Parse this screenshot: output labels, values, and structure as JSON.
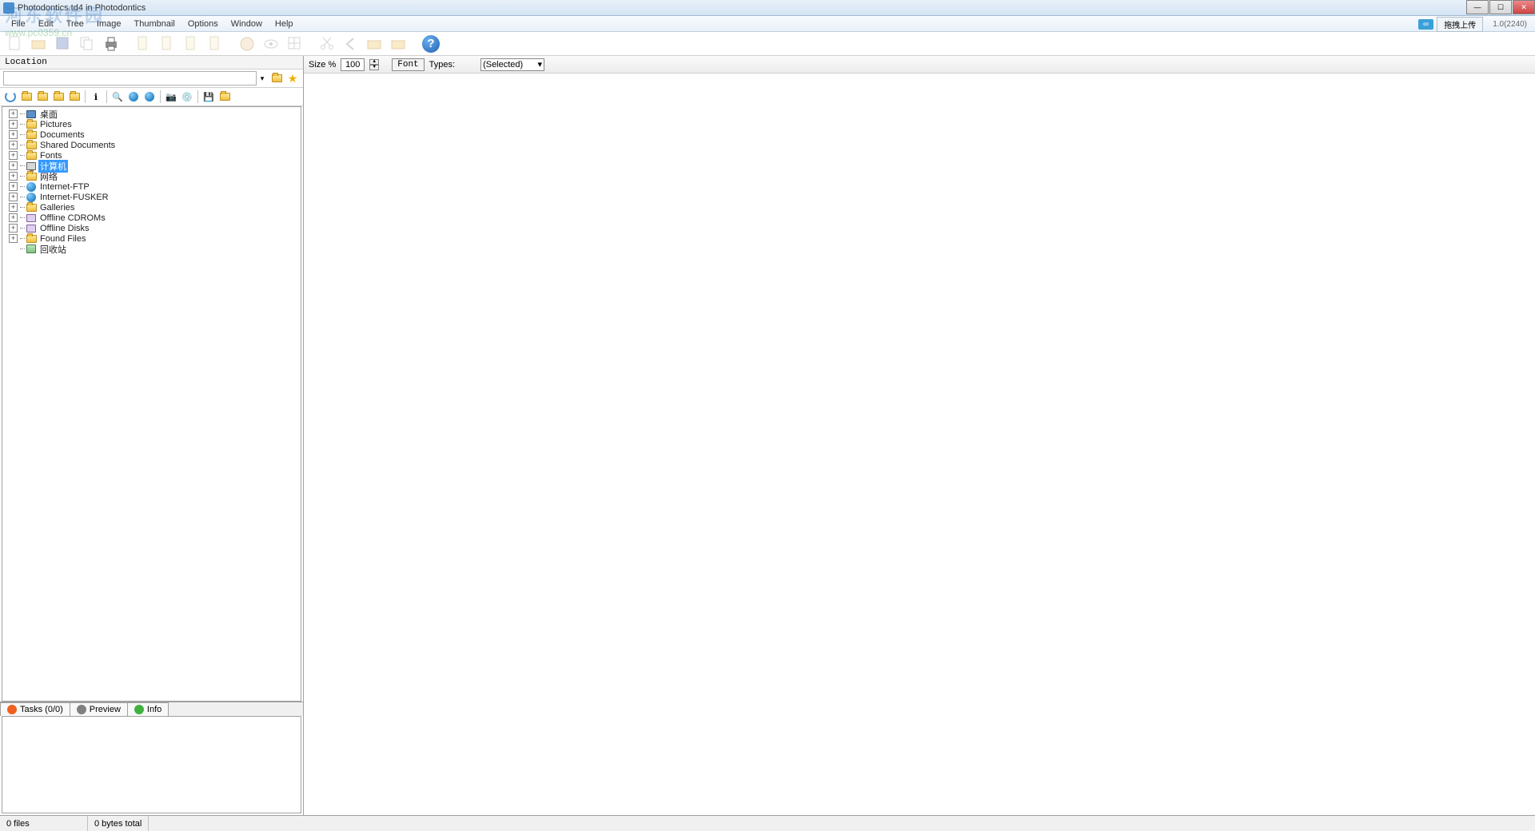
{
  "window": {
    "title": "Photodontics.td4 in Photodontics",
    "version": "1.0(2240)",
    "upload_label": "拖拽上传"
  },
  "menubar": [
    "File",
    "Edit",
    "Tree",
    "Image",
    "Thumbnail",
    "Options",
    "Window",
    "Help"
  ],
  "watermark": {
    "line1": "河东软件园",
    "line2": "www.pc0359.cn"
  },
  "location": {
    "label": "Location",
    "value": ""
  },
  "tree": [
    {
      "icon": "desktop",
      "label": "桌面",
      "expandable": true,
      "selected": false
    },
    {
      "icon": "folder",
      "label": "Pictures",
      "expandable": true,
      "selected": false
    },
    {
      "icon": "folder",
      "label": "Documents",
      "expandable": true,
      "selected": false
    },
    {
      "icon": "folder",
      "label": "Shared Documents",
      "expandable": true,
      "selected": false
    },
    {
      "icon": "folder",
      "label": "Fonts",
      "expandable": true,
      "selected": false
    },
    {
      "icon": "computer",
      "label": "计算机",
      "expandable": true,
      "selected": true
    },
    {
      "icon": "folder",
      "label": "网络",
      "expandable": true,
      "selected": false
    },
    {
      "icon": "globe",
      "label": "Internet-FTP",
      "expandable": true,
      "selected": false
    },
    {
      "icon": "globe",
      "label": "Internet-FUSKER",
      "expandable": true,
      "selected": false
    },
    {
      "icon": "folder",
      "label": "Galleries",
      "expandable": true,
      "selected": false
    },
    {
      "icon": "disk",
      "label": "Offline CDROMs",
      "expandable": true,
      "selected": false
    },
    {
      "icon": "disk",
      "label": "Offline Disks",
      "expandable": true,
      "selected": false
    },
    {
      "icon": "folder",
      "label": "Found Files",
      "expandable": true,
      "selected": false
    },
    {
      "icon": "recycle",
      "label": "回收站",
      "expandable": false,
      "selected": false
    }
  ],
  "bottom_tabs": {
    "tasks": "Tasks (0/0)",
    "preview": "Preview",
    "info": "Info"
  },
  "thumb_bar": {
    "size_label": "Size %",
    "size_value": "100",
    "font_label": "Font",
    "types_label": "Types:",
    "selected_label": "(Selected)"
  },
  "statusbar": {
    "files": "0 files",
    "bytes": "0 bytes total"
  }
}
